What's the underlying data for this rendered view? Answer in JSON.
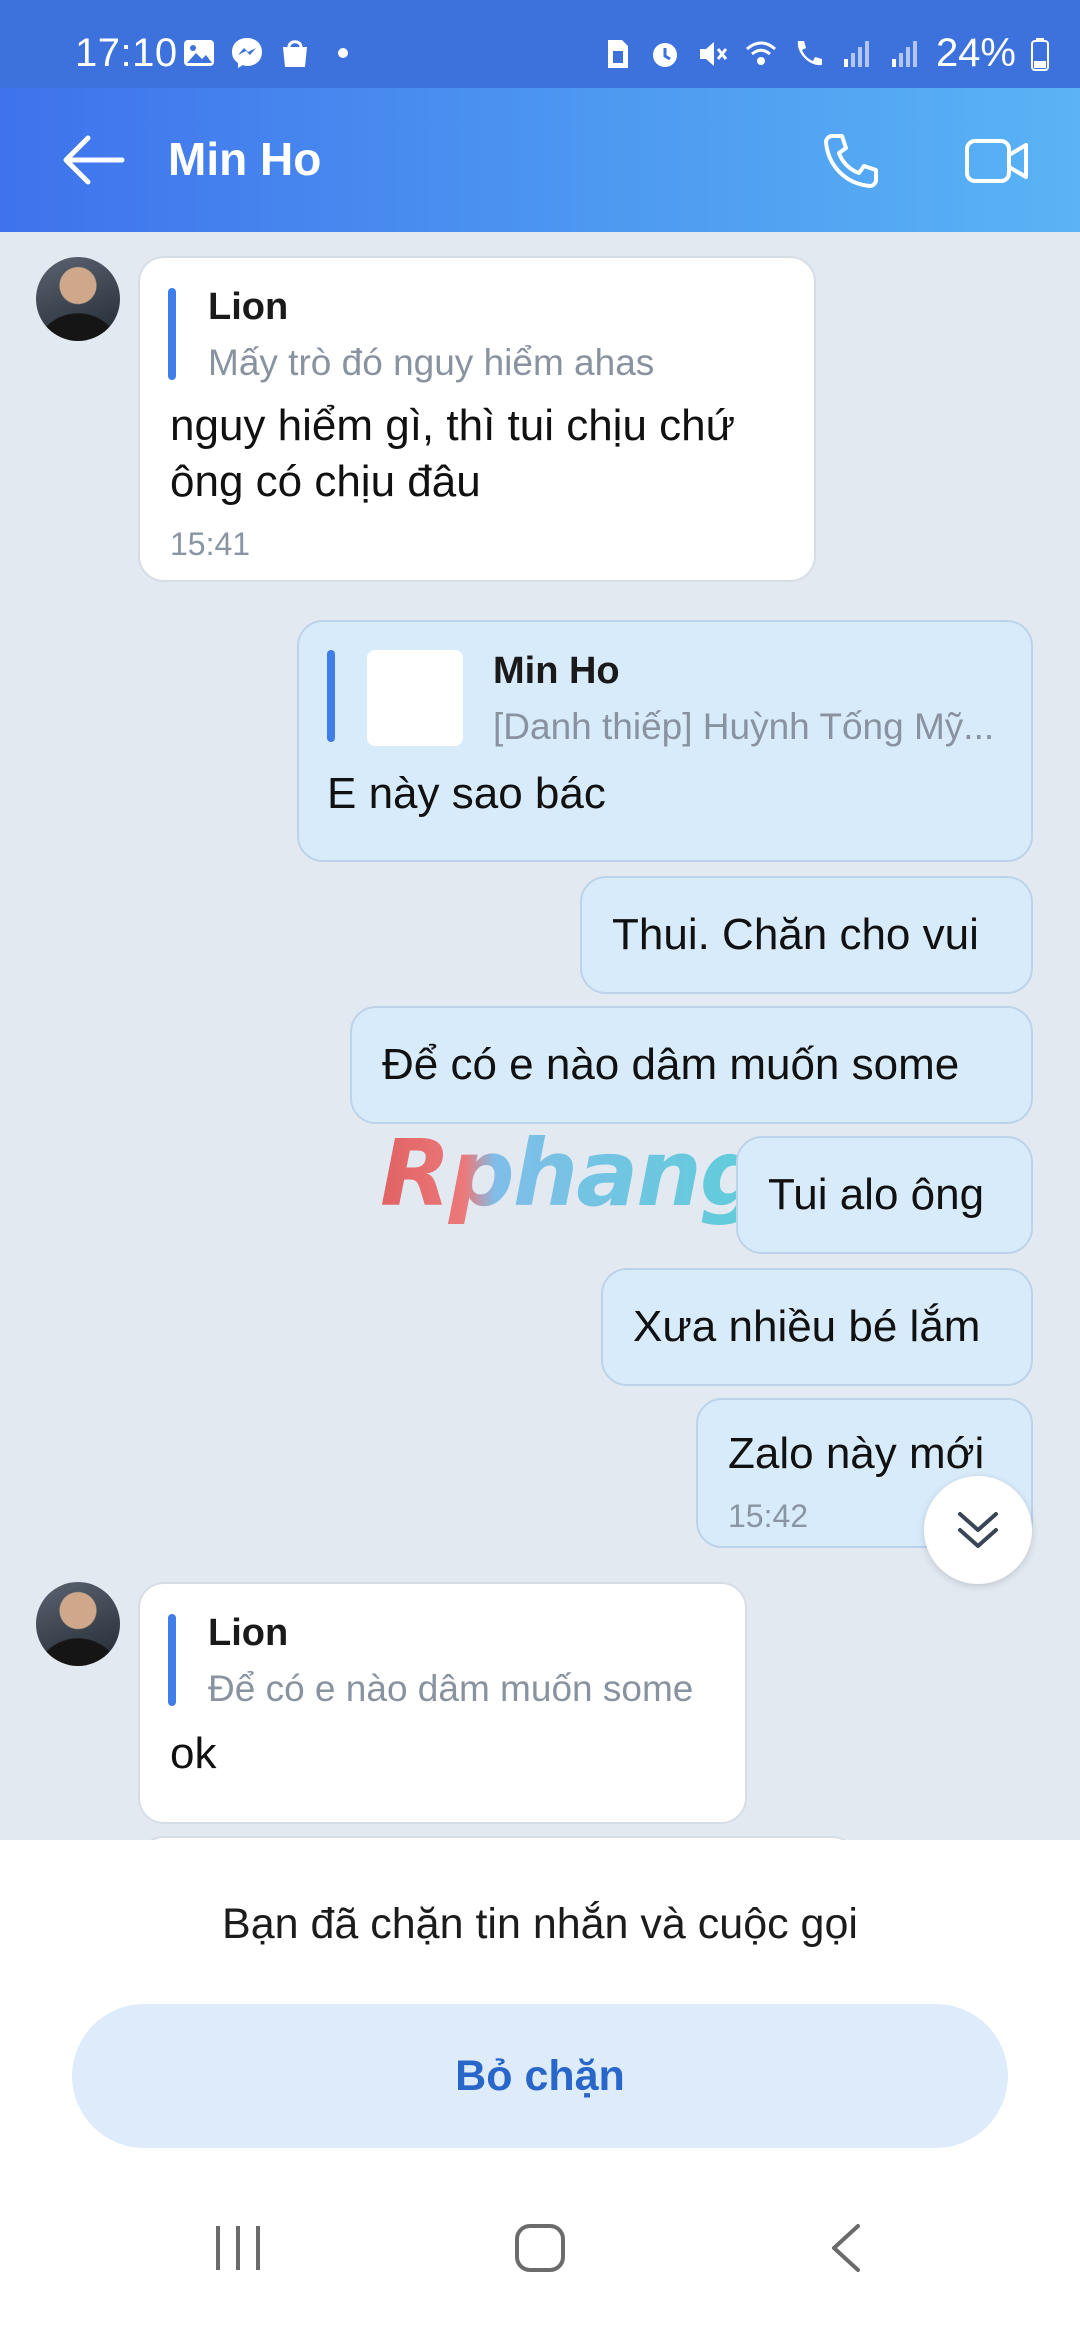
{
  "status_bar": {
    "time": "17:10",
    "battery": "24%",
    "left_icons": [
      "gallery-icon",
      "messenger-icon",
      "shopping-bag-icon",
      "dot-icon"
    ],
    "right_icons": [
      "sim-icon",
      "alarm-icon",
      "mute-icon",
      "wifi-calling-icon",
      "call-signal-icon",
      "signal-icon",
      "signal-icon",
      "battery-icon"
    ]
  },
  "header": {
    "title": "Min Ho",
    "icons": [
      "back-arrow-icon",
      "phone-icon",
      "video-camera-icon"
    ]
  },
  "messages": [
    {
      "direction": "incoming",
      "quote_name": "Lion",
      "quote_text": "Mấy trò đó nguy hiểm ahas",
      "text_line1": "nguy hiểm gì, thì tui chịu chứ",
      "text_line2": "ông có chịu đâu",
      "time": "15:41"
    },
    {
      "direction": "outgoing",
      "quote_name": "Min Ho",
      "quote_text": "[Danh thiếp] Huỳnh Tống Mỹ...",
      "text": "E này sao bác"
    },
    {
      "direction": "outgoing",
      "text": "Thui. Chăn cho vui"
    },
    {
      "direction": "outgoing",
      "text": "Để có e nào dâm muốn some"
    },
    {
      "direction": "outgoing",
      "text": "Tui alo ông"
    },
    {
      "direction": "outgoing",
      "text": "Xưa nhiều bé lắm"
    },
    {
      "direction": "outgoing",
      "text": "Zalo này mới",
      "time": "15:42"
    },
    {
      "direction": "incoming",
      "quote_name": "Lion",
      "quote_text": "Để có e nào dâm muốn some",
      "text": "ok"
    }
  ],
  "watermark": "Rphang",
  "bottom_panel": {
    "blocked_text": "Bạn đã chặn tin nhắn và cuộc gọi",
    "unblock_label": "Bỏ chặn"
  },
  "nav_bar": {
    "icons": [
      "recent-apps-icon",
      "home-icon",
      "back-icon"
    ]
  },
  "colors": {
    "header_start": "#3f72ec",
    "header_end": "#5ab4f5",
    "chat_bg": "#e2e9f1",
    "outgoing_bubble": "#d8ebfb",
    "incoming_bubble": "#ffffff",
    "quote_bar": "#3f7ee8",
    "unblock_button": "#deebfb",
    "unblock_text": "#2867c9"
  }
}
